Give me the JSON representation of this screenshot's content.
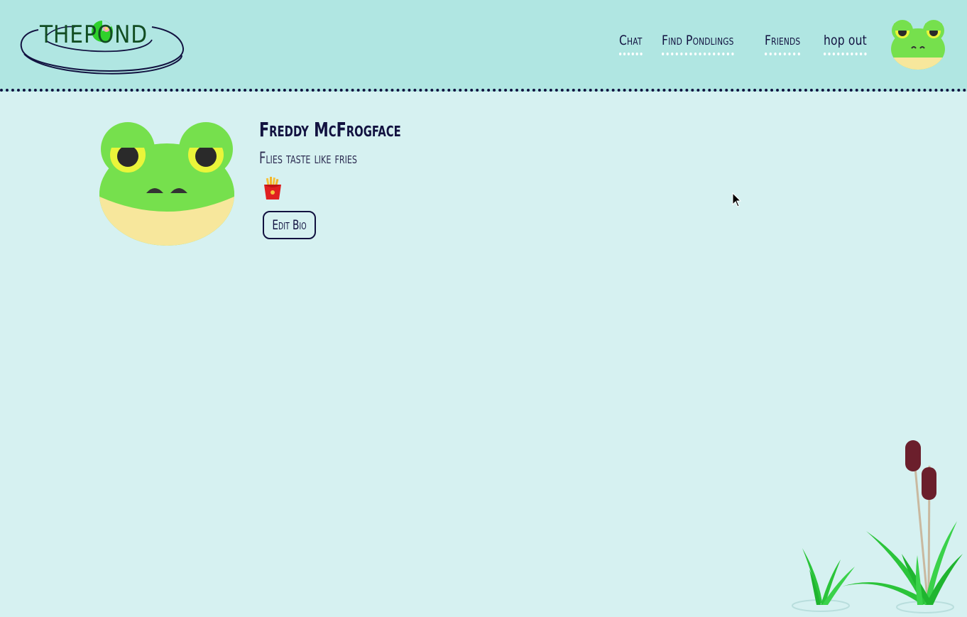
{
  "header": {
    "logo_text": "THEPOND",
    "nav": {
      "chat": "Chat",
      "find_pondlings": "Find Pondlings",
      "friends": "Friends",
      "hop_out": "hop out"
    },
    "avatar_icon": "frog-face-icon"
  },
  "profile": {
    "name": "Freddy McFrogface",
    "bio": "Flies taste like fries",
    "emoji_icon": "french-fries-icon",
    "edit_bio_label": "Edit Bio",
    "picture_icon": "frog-face-icon"
  },
  "decor": {
    "cattails_icon": "cattails-grass-icon"
  },
  "colors": {
    "header_bg": "#b0e6e2",
    "page_bg": "#d6f1f1",
    "text": "#121240",
    "frog_green": "#76e04d",
    "frog_belly": "#f7e79c",
    "frog_eye": "#eaf53a"
  }
}
